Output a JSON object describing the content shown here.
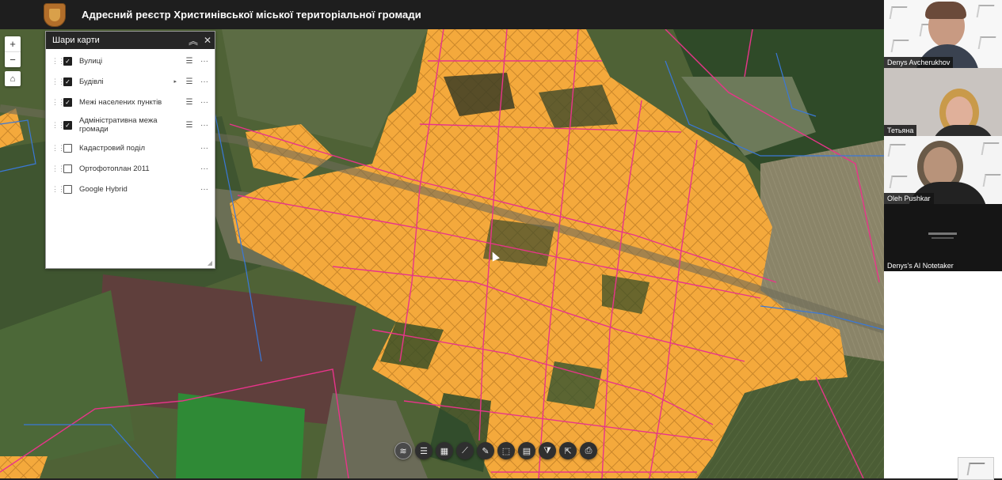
{
  "app": {
    "title": "Адресний реєстр Христинівської міської територіальної громади",
    "logo_icon": "coat-of-arms-icon"
  },
  "map_controls": {
    "zoom_in": "+",
    "zoom_out": "−",
    "home_icon": "home-icon"
  },
  "layers_panel": {
    "title": "Шари карти",
    "collapse_icon": "chevron-up-double-icon",
    "close_icon": "close-icon",
    "items": [
      {
        "label": "Вулиці",
        "checked": true,
        "legend": true
      },
      {
        "label": "Будівлі",
        "checked": true,
        "legend": true,
        "expand": true
      },
      {
        "label": "Межі населених пунктів",
        "checked": true,
        "legend": true
      },
      {
        "label": "Адміністративна межа громади",
        "checked": true,
        "legend": true
      },
      {
        "label": "Кадастровий поділ",
        "checked": false,
        "legend": false
      },
      {
        "label": "Ортофотоплан 2011",
        "checked": false,
        "legend": false
      },
      {
        "label": "Google Hybrid",
        "checked": false,
        "legend": false
      }
    ]
  },
  "toolbar": {
    "icons": [
      "layers-icon",
      "legend-icon",
      "basemap-icon",
      "measure-icon",
      "draw-icon",
      "select-icon",
      "table-icon",
      "filter-icon",
      "share-icon",
      "print-icon"
    ]
  },
  "participants": [
    {
      "name": "Denys Avcherukhov"
    },
    {
      "name": "Тетьяна"
    },
    {
      "name": "Oleh Pushkar"
    },
    {
      "name": "Denys's AI Notetaker"
    }
  ],
  "colors": {
    "building_fill": "#f4a93c",
    "parcel_line": "#e8348a",
    "boundary_line": "#3a78d8",
    "header_bg": "#1e1e1e"
  }
}
